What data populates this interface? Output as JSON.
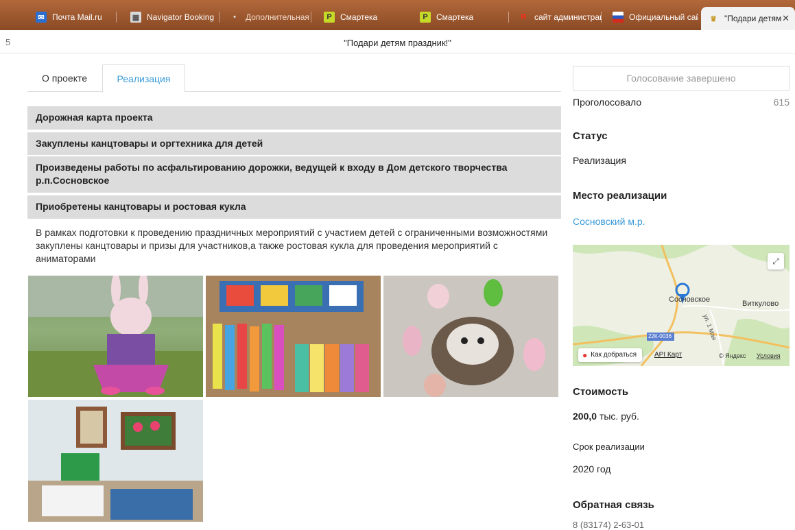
{
  "browser": {
    "tabs": [
      {
        "label": "Почта Mail.ru",
        "icon": "mail-icon"
      },
      {
        "label": "Navigator Booking",
        "icon": "booking-icon"
      },
      {
        "label": "Дополнительная с",
        "icon": "doc-icon"
      },
      {
        "label": "Смартека",
        "icon": "smarteka-icon"
      },
      {
        "label": "Смартека",
        "icon": "smarteka-icon"
      },
      {
        "label": "сайт администрац",
        "icon": "yandex-icon"
      },
      {
        "label": "Официальный сай",
        "icon": "flag-icon"
      },
      {
        "label": "\"Подари детям",
        "icon": "emblem-icon"
      }
    ]
  },
  "page": {
    "number": "5",
    "title": "\"Подари детям праздник!\""
  },
  "tabs": [
    {
      "label": "О проекте"
    },
    {
      "label": "Реализация"
    }
  ],
  "accordion": [
    {
      "title": "Дорожная карта проекта"
    },
    {
      "title": "Закуплены канцтовары и оргтехника для детей"
    },
    {
      "title": "Произведены работы по асфальтированию дорожки, ведущей к входу в Дом детского творчества р.п.Сосновское"
    },
    {
      "title": "Приобретены канцтовары и ростовая кукла"
    }
  ],
  "description": "В рамках подготовки к проведению праздничных мероприятий с участием детей с ограниченными возможностями закуплены канцтовары и призы для участников,а также ростовая кукла для проведения мероприятий с аниматорами",
  "sidebar": {
    "vote_button": "Голосование завершено",
    "voted_label": "Проголосовало",
    "voted_count": "615",
    "status_heading": "Статус",
    "status_value": "Реализация",
    "place_heading": "Место реализации",
    "place_link": "Сосновский м.р.",
    "cost_heading": "Стоимость",
    "cost_value": "200,0",
    "cost_unit": "тыс. руб.",
    "term_label": "Срок реализации",
    "term_value": "2020 год",
    "feedback_heading": "Обратная связь",
    "phone": "8 (83174) 2-63-01"
  },
  "map": {
    "town": "Сосновское",
    "village": "Виткулово",
    "road": "22К-0036",
    "street": "ул. 1 Мая",
    "route_button": "Как добраться",
    "api_link": "API Карт",
    "copyright": "© Яндекс",
    "terms_link": "Условия"
  },
  "colors": {
    "accent": "#3a9bd9",
    "accordion_bg": "#dcdcdc"
  }
}
